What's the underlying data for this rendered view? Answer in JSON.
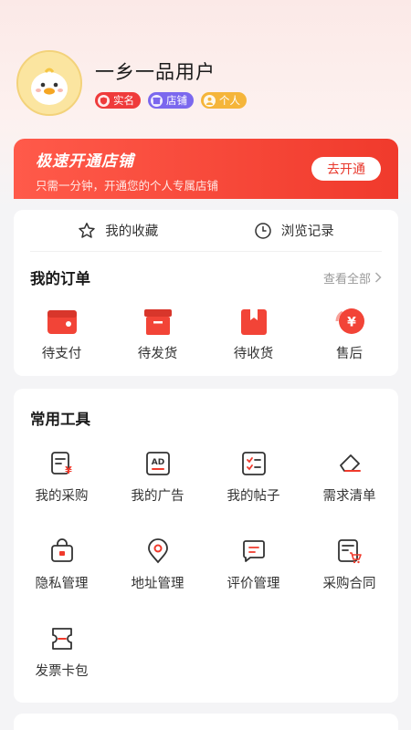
{
  "profile": {
    "username": "一乡一品用户",
    "badges": [
      {
        "label": "实名",
        "icon": "shield-icon",
        "color": "#ef3b3b"
      },
      {
        "label": "店铺",
        "icon": "store-icon",
        "color": "#7b68ee"
      },
      {
        "label": "个人",
        "icon": "person-icon",
        "color": "#f5b53a"
      }
    ]
  },
  "shop_banner": {
    "title": "极速开通店铺",
    "subtitle": "只需一分钟，开通您的个人专属店铺",
    "button": "去开通"
  },
  "quick_links": [
    {
      "label": "我的收藏",
      "icon": "star-icon"
    },
    {
      "label": "浏览记录",
      "icon": "clock-icon"
    }
  ],
  "orders": {
    "title": "我的订单",
    "see_all": "查看全部",
    "items": [
      {
        "label": "待支付",
        "icon": "wallet-icon"
      },
      {
        "label": "待发货",
        "icon": "box-icon"
      },
      {
        "label": "待收货",
        "icon": "package-icon"
      },
      {
        "label": "售后",
        "icon": "refund-icon"
      }
    ]
  },
  "tools": {
    "title": "常用工具",
    "items": [
      {
        "label": "我的采购",
        "icon": "purchase-doc-icon"
      },
      {
        "label": "我的广告",
        "icon": "ad-icon"
      },
      {
        "label": "我的帖子",
        "icon": "checklist-icon"
      },
      {
        "label": "需求清单",
        "icon": "eraser-icon"
      },
      {
        "label": "隐私管理",
        "icon": "lock-bag-icon"
      },
      {
        "label": "地址管理",
        "icon": "location-pin-icon"
      },
      {
        "label": "评价管理",
        "icon": "comment-icon"
      },
      {
        "label": "采购合同",
        "icon": "contract-cart-icon"
      },
      {
        "label": "发票卡包",
        "icon": "invoice-icon"
      }
    ]
  },
  "colors": {
    "accent": "#ef3b3b",
    "banner": "#f03a2c"
  }
}
